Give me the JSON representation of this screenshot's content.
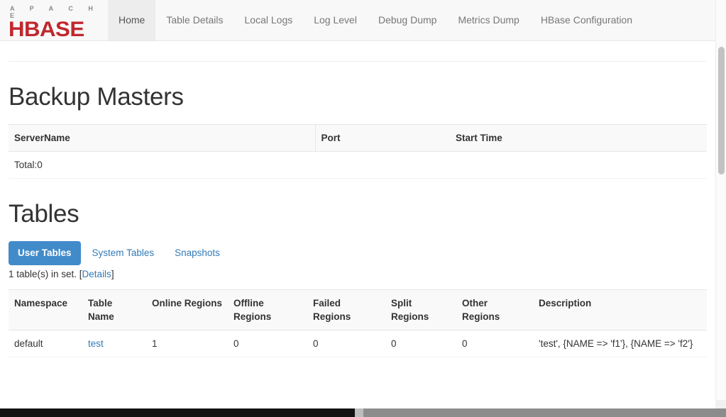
{
  "brand": {
    "apache": "A P A C H E",
    "hbase": "HBASE"
  },
  "nav": {
    "items": [
      {
        "label": "Home",
        "active": true
      },
      {
        "label": "Table Details",
        "active": false
      },
      {
        "label": "Local Logs",
        "active": false
      },
      {
        "label": "Log Level",
        "active": false
      },
      {
        "label": "Debug Dump",
        "active": false
      },
      {
        "label": "Metrics Dump",
        "active": false
      },
      {
        "label": "HBase Configuration",
        "active": false
      }
    ]
  },
  "backup_masters": {
    "title": "Backup Masters",
    "columns": [
      "ServerName",
      "Port",
      "Start Time"
    ],
    "rows": [],
    "total_label": "Total:0"
  },
  "tables": {
    "title": "Tables",
    "tabs": [
      {
        "label": "User Tables",
        "active": true
      },
      {
        "label": "System Tables",
        "active": false
      },
      {
        "label": "Snapshots",
        "active": false
      }
    ],
    "set_info_text": "1 table(s) in set. [",
    "set_info_link": "Details",
    "set_info_suffix": "]",
    "columns": [
      "Namespace",
      "Table Name",
      "Online Regions",
      "Offline Regions",
      "Failed Regions",
      "Split Regions",
      "Other Regions",
      "Description"
    ],
    "rows": [
      {
        "namespace": "default",
        "table_name": "test",
        "online_regions": "1",
        "offline_regions": "0",
        "failed_regions": "0",
        "split_regions": "0",
        "other_regions": "0",
        "description": "'test', {NAME => 'f1'}, {NAME => 'f2'}"
      }
    ]
  },
  "colors": {
    "brand_red": "#c1272d",
    "accent_blue": "#428bca",
    "link_blue": "#337ab7",
    "navbar_bg": "#f8f8f8",
    "table_header_bg": "#f9f9f9"
  }
}
